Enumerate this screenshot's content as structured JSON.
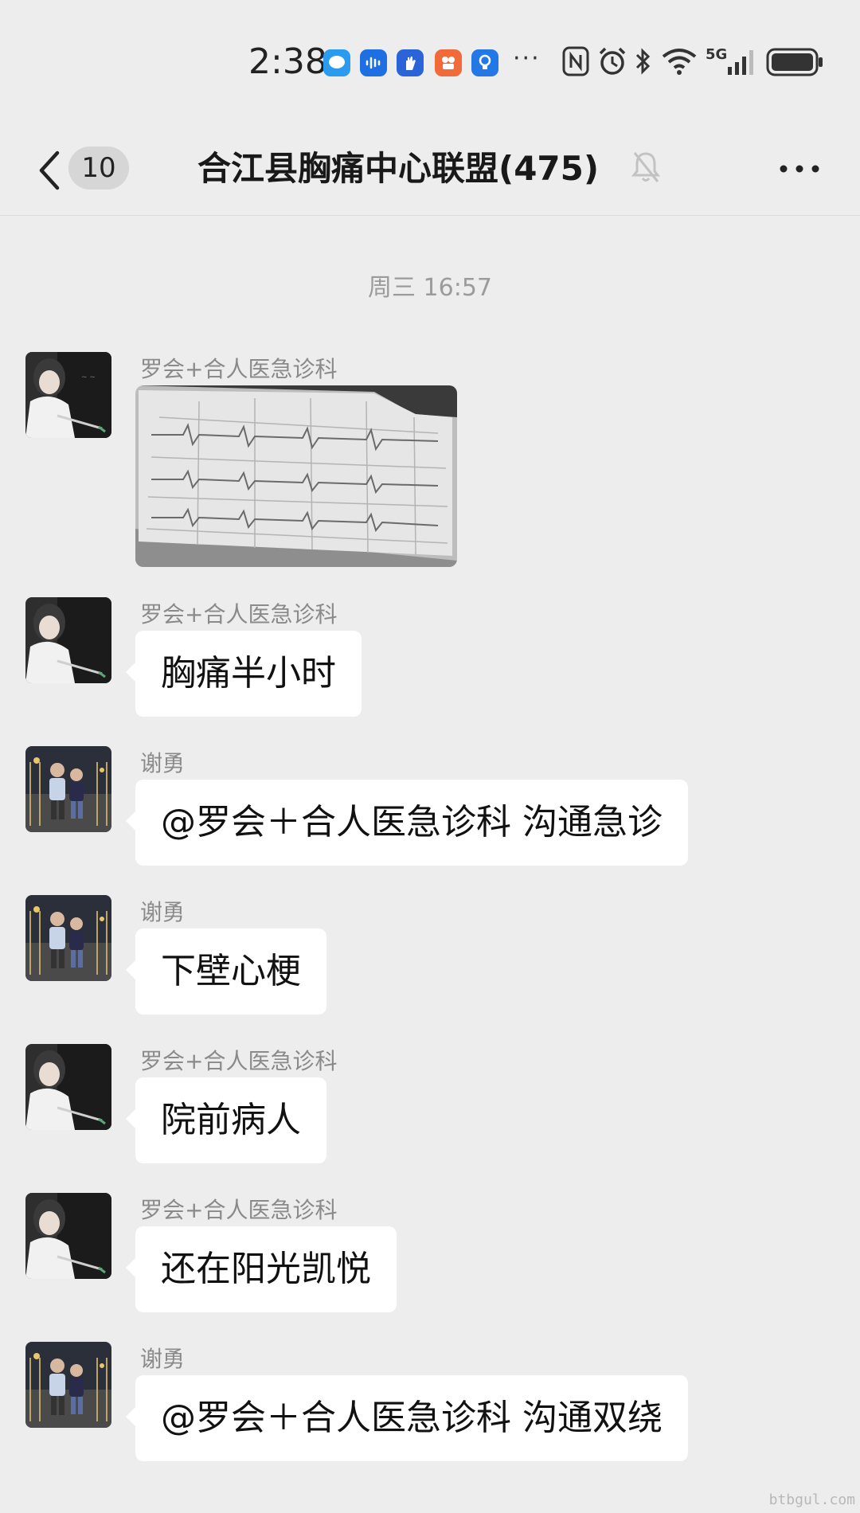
{
  "status_bar": {
    "time": "2:38",
    "network": "5G",
    "icons": [
      "message-app-icon",
      "voice-app-icon",
      "hand-app-icon",
      "video-app-icon",
      "bulb-app-icon",
      "more-dots",
      "nfc-icon",
      "alarm-icon",
      "bluetooth-icon",
      "wifi-icon",
      "signal-icon",
      "battery-icon"
    ]
  },
  "nav": {
    "unread_count": "10",
    "title": "合江县胸痛中心联盟(475)"
  },
  "chat": {
    "timestamp": "周三 16:57",
    "messages": [
      {
        "sender": "罗会+合人医急诊科",
        "type": "image"
      },
      {
        "sender": "罗会+合人医急诊科",
        "type": "text",
        "text": "胸痛半小时"
      },
      {
        "sender": "谢勇",
        "type": "text",
        "text": "@罗会＋合人医急诊科  沟通急诊"
      },
      {
        "sender": "谢勇",
        "type": "text",
        "text": "下壁心梗"
      },
      {
        "sender": "罗会+合人医急诊科",
        "type": "text",
        "text": "院前病人"
      },
      {
        "sender": "罗会+合人医急诊科",
        "type": "text",
        "text": "还在阳光凯悦"
      },
      {
        "sender": "谢勇",
        "type": "text",
        "text": "@罗会＋合人医急诊科  沟通双绕"
      }
    ]
  },
  "watermark": "btbgul.com",
  "colors": {
    "background": "#ededed",
    "bubble": "#ffffff",
    "sender_text": "#8a8a8a"
  }
}
